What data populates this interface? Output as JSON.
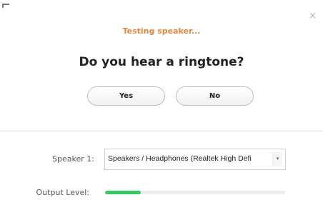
{
  "dialog": {
    "status_text": "Testing speaker...",
    "question": "Do you hear a ringtone?",
    "yes_label": "Yes",
    "no_label": "No",
    "close_glyph": "×"
  },
  "speaker": {
    "label": "Speaker 1:",
    "selected": "Speakers / Headphones (Realtek High Defi",
    "arrow_glyph": "▾"
  },
  "output": {
    "label": "Output Level:",
    "level_percent": 20
  },
  "colors": {
    "status_accent": "#e2883d",
    "meter_fill": "#35c760"
  }
}
